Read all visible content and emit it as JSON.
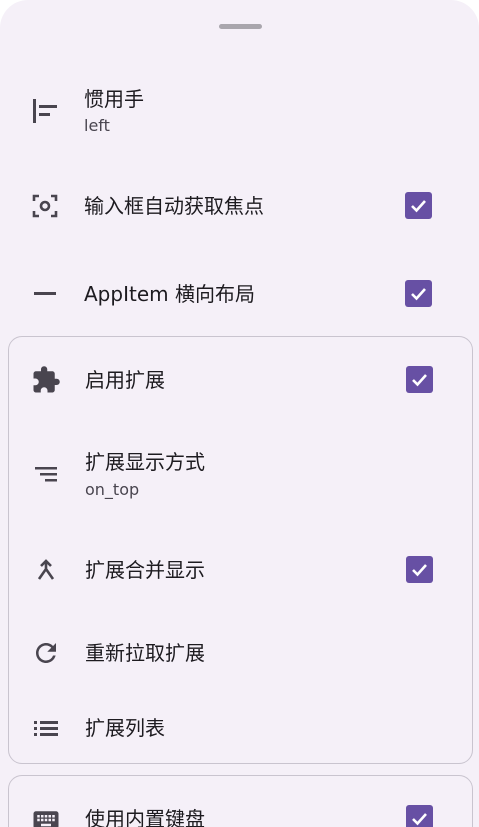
{
  "settings": {
    "handedness": {
      "title": "惯用手",
      "value": "left"
    },
    "autofocus": {
      "title": "输入框自动获取焦点",
      "checked": true
    },
    "appitem_layout": {
      "title": "AppItem 横向布局",
      "checked": true
    }
  },
  "extension_group": {
    "enable": {
      "title": "启用扩展",
      "checked": true
    },
    "display_mode": {
      "title": "扩展显示方式",
      "value": "on_top"
    },
    "merge_display": {
      "title": "扩展合并显示",
      "checked": true
    },
    "refetch": {
      "title": "重新拉取扩展"
    },
    "list": {
      "title": "扩展列表"
    }
  },
  "keyboard_group": {
    "builtin_keyboard": {
      "title": "使用内置键盘",
      "checked": true
    }
  },
  "colors": {
    "accent": "#6750a4",
    "background": "#f5f0f8",
    "outline": "#c9c4cf"
  }
}
